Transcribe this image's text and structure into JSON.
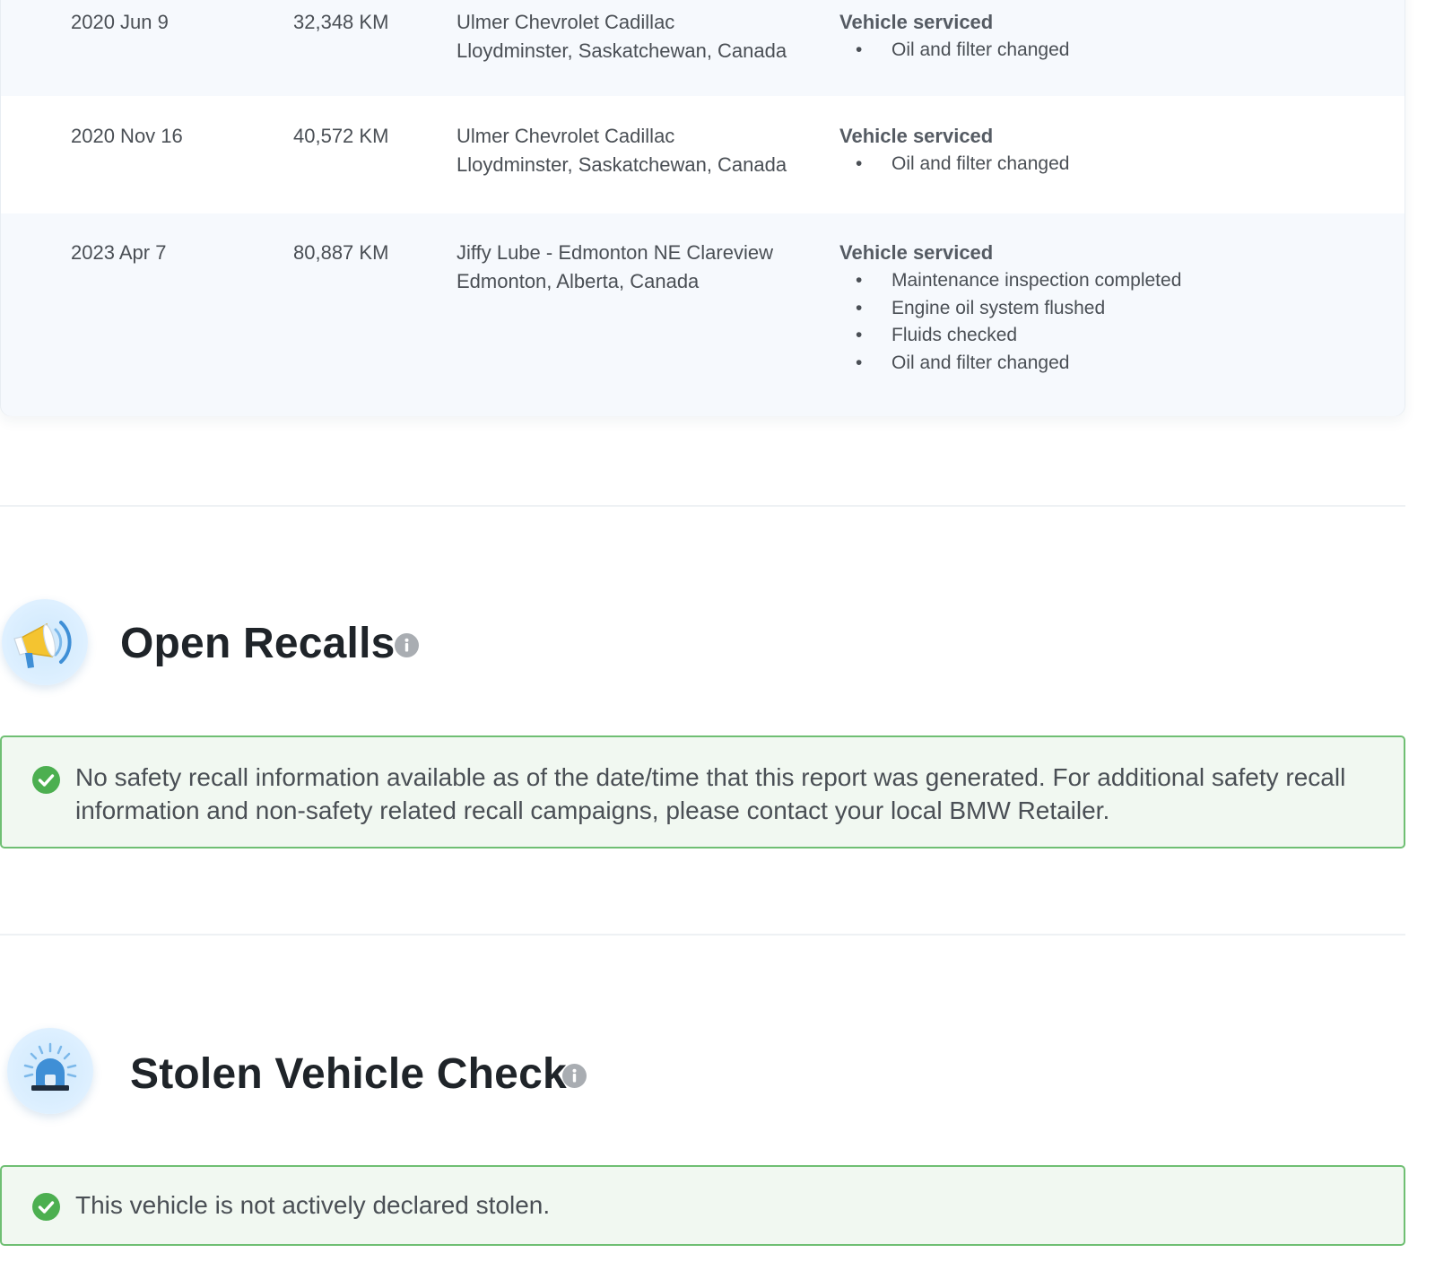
{
  "service_history": {
    "rows": [
      {
        "date": "2020 Jun 9",
        "odometer": "32,348 KM",
        "location_name": "Ulmer Chevrolet Cadillac",
        "location_city": "Lloydminster, Saskatchewan, Canada",
        "work_title": "Vehicle serviced",
        "items": [
          "Oil and filter changed"
        ]
      },
      {
        "date": "2020 Nov 16",
        "odometer": "40,572 KM",
        "location_name": "Ulmer Chevrolet Cadillac",
        "location_city": "Lloydminster, Saskatchewan, Canada",
        "work_title": "Vehicle serviced",
        "items": [
          "Oil and filter changed"
        ]
      },
      {
        "date": "2023 Apr 7",
        "odometer": "80,887 KM",
        "location_name": "Jiffy Lube - Edmonton NE Clareview",
        "location_city": "Edmonton, Alberta, Canada",
        "work_title": "Vehicle serviced",
        "items": [
          "Maintenance inspection completed",
          "Engine oil system flushed",
          "Fluids checked",
          "Oil and filter changed"
        ]
      }
    ],
    "bullet": "•"
  },
  "recalls": {
    "title": "Open Recalls",
    "icon": "megaphone-icon",
    "message": "No safety recall information available as of the date/time that this report was generated. For additional safety recall information and non-safety related recall campaigns, please contact your local BMW Retailer."
  },
  "stolen": {
    "title": "Stolen Vehicle Check",
    "icon": "siren-icon",
    "message": "This vehicle is not actively declared stolen."
  },
  "colors": {
    "success_border": "#6fbf73",
    "success_bg": "#f1f8f1",
    "check_green": "#4caf50",
    "info_gray": "#a9adb2",
    "icon_bg": "#dcefff"
  }
}
